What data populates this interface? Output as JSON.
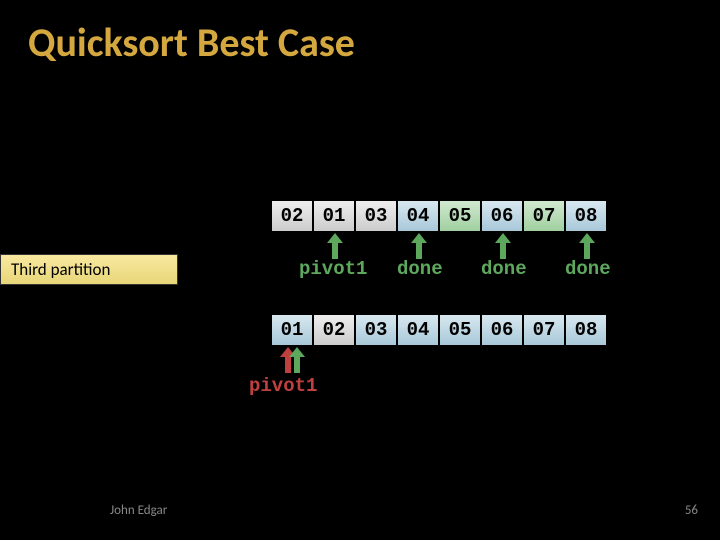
{
  "title": "Quicksort Best Case",
  "partitionLabel": "Third partition",
  "row1": {
    "cells": [
      "02",
      "01",
      "03",
      "04",
      "05",
      "06",
      "07",
      "08"
    ]
  },
  "row2": {
    "cells": [
      "01",
      "02",
      "03",
      "04",
      "05",
      "06",
      "07",
      "08"
    ]
  },
  "labels": {
    "pivot": "pivot1",
    "done": "done"
  },
  "footer": {
    "author": "John Edgar",
    "page": "56"
  },
  "chart_data": {
    "type": "table",
    "title": "Quicksort Best Case — third partition step",
    "rows": [
      {
        "values": [
          "02",
          "01",
          "03",
          "04",
          "05",
          "06",
          "07",
          "08"
        ],
        "cell_styles": [
          "gray",
          "gray",
          "gray",
          "blue",
          "green",
          "blue",
          "green",
          "blue"
        ],
        "annotations": [
          {
            "under_index": 1,
            "text": "pivot1",
            "color": "green",
            "arrow_color": "green"
          },
          {
            "under_index": 3,
            "text": "done",
            "color": "green",
            "arrow_color": "green"
          },
          {
            "under_index": 5,
            "text": "done",
            "color": "green",
            "arrow_color": "green"
          },
          {
            "under_index": 7,
            "text": "done",
            "color": "green",
            "arrow_color": "green"
          }
        ]
      },
      {
        "values": [
          "01",
          "02",
          "03",
          "04",
          "05",
          "06",
          "07",
          "08"
        ],
        "cell_styles": [
          "blue",
          "gray",
          "blue",
          "blue",
          "blue",
          "blue",
          "blue",
          "blue"
        ],
        "annotations": [
          {
            "under_index": 0,
            "text": "pivot1",
            "color": "red",
            "arrows": [
              "red",
              "green"
            ]
          }
        ]
      }
    ]
  }
}
